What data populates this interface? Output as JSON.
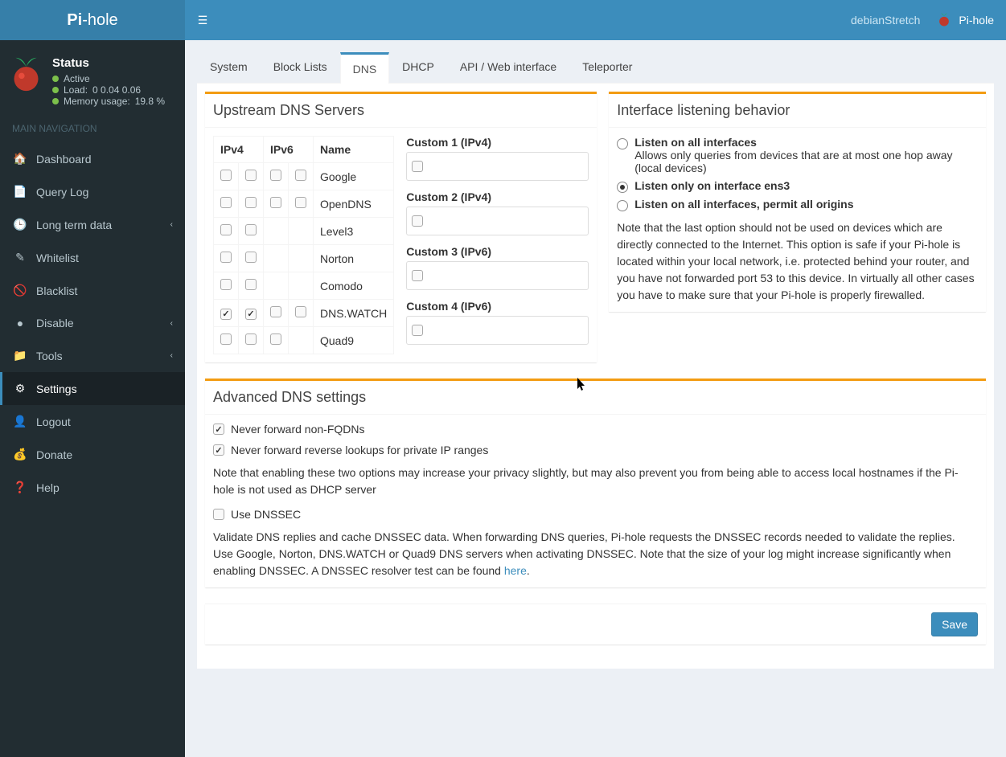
{
  "brand": {
    "b": "Pi",
    "rest": "-hole"
  },
  "topbar": {
    "hostname": "debianStretch",
    "brand": "Pi-hole"
  },
  "status": {
    "title": "Status",
    "active": "Active",
    "load_label": "Load:",
    "load_values": "0  0.04  0.06",
    "mem_label": "Memory usage:",
    "mem_value": "19.8 %"
  },
  "nav_header": "MAIN NAVIGATION",
  "nav": [
    {
      "label": "Dashboard",
      "icon": "🏠"
    },
    {
      "label": "Query Log",
      "icon": "📄"
    },
    {
      "label": "Long term data",
      "icon": "🕒",
      "sub": true
    },
    {
      "label": "Whitelist",
      "icon": "✎"
    },
    {
      "label": "Blacklist",
      "icon": "🚫"
    },
    {
      "label": "Disable",
      "icon": "●",
      "sub": true
    },
    {
      "label": "Tools",
      "icon": "📁",
      "sub": true
    },
    {
      "label": "Settings",
      "icon": "⚙",
      "active": true
    },
    {
      "label": "Logout",
      "icon": "👤"
    },
    {
      "label": "Donate",
      "icon": "💰"
    },
    {
      "label": "Help",
      "icon": "❓"
    }
  ],
  "tabs": [
    "System",
    "Block Lists",
    "DNS",
    "DHCP",
    "API / Web interface",
    "Teleporter"
  ],
  "active_tab": "DNS",
  "upstream": {
    "title": "Upstream DNS Servers",
    "headers": {
      "ipv4": "IPv4",
      "ipv6": "IPv6",
      "name": "Name"
    },
    "rows": [
      {
        "name": "Google",
        "v4": [
          false,
          false
        ],
        "v6": [
          false,
          false
        ]
      },
      {
        "name": "OpenDNS",
        "v4": [
          false,
          false
        ],
        "v6": [
          false,
          false
        ]
      },
      {
        "name": "Level3",
        "v4": [
          false,
          false
        ],
        "v6": null
      },
      {
        "name": "Norton",
        "v4": [
          false,
          false
        ],
        "v6": null
      },
      {
        "name": "Comodo",
        "v4": [
          false,
          false
        ],
        "v6": null
      },
      {
        "name": "DNS.WATCH",
        "v4": [
          true,
          true
        ],
        "v6": [
          false,
          false
        ]
      },
      {
        "name": "Quad9",
        "v4": [
          false,
          false
        ],
        "v6": [
          false
        ]
      }
    ],
    "custom": [
      {
        "label": "Custom 1 (IPv4)",
        "checked": false,
        "value": ""
      },
      {
        "label": "Custom 2 (IPv4)",
        "checked": false,
        "value": ""
      },
      {
        "label": "Custom 3 (IPv6)",
        "checked": false,
        "value": ""
      },
      {
        "label": "Custom 4 (IPv6)",
        "checked": false,
        "value": ""
      }
    ]
  },
  "interface": {
    "title": "Interface listening behavior",
    "opts": [
      {
        "label": "Listen on all interfaces",
        "desc": "Allows only queries from devices that are at most one hop away (local devices)",
        "selected": false
      },
      {
        "label": "Listen only on interface ens3",
        "desc": "",
        "selected": true
      },
      {
        "label": "Listen on all interfaces, permit all origins",
        "desc": "",
        "selected": false
      }
    ],
    "note": "Note that the last option should not be used on devices which are directly connected to the Internet. This option is safe if your Pi-hole is located within your local network, i.e. protected behind your router, and you have not forwarded port 53 to this device. In virtually all other cases you have to make sure that your Pi-hole is properly firewalled."
  },
  "advanced": {
    "title": "Advanced DNS settings",
    "opt1": {
      "label": "Never forward non-FQDNs",
      "checked": true
    },
    "opt2": {
      "label": "Never forward reverse lookups for private IP ranges",
      "checked": true
    },
    "note1": "Note that enabling these two options may increase your privacy slightly, but may also prevent you from being able to access local hostnames if the Pi-hole is not used as DHCP server",
    "opt3": {
      "label": "Use DNSSEC",
      "checked": false
    },
    "note2a": "Validate DNS replies and cache DNSSEC data. When forwarding DNS queries, Pi-hole requests the DNSSEC records needed to validate the replies. Use Google, Norton, DNS.WATCH or Quad9 DNS servers when activating DNSSEC. Note that the size of your log might increase significantly when enabling DNSSEC. A DNSSEC resolver test can be found ",
    "note2link": "here",
    "note2b": "."
  },
  "save": "Save"
}
